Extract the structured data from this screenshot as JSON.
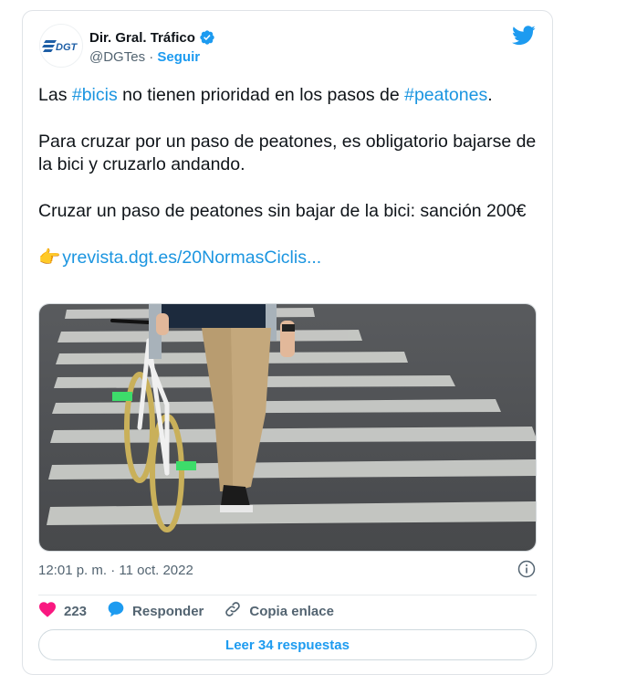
{
  "account": {
    "display_name": "Dir. Gral. Tráfico",
    "handle": "@DGTes",
    "separator": "·",
    "follow_label": "Seguir",
    "logo_text": "DGT"
  },
  "tweet": {
    "para1": {
      "t1": "Las ",
      "h1": "#bicis",
      "t2": " no tienen prioridad en los pasos de ",
      "h2": "#peatones",
      "t3": "."
    },
    "para2": "Para cruzar por un paso de peatones, es obligatorio bajarse de la bici y cruzarlo andando.",
    "para3": "Cruzar un paso de peatones sin bajar de la bici: sanción 200€",
    "link_emoji": "👉",
    "link_text": "yrevista.dgt.es/20NormasCiclis..."
  },
  "timestamp": "12:01 p. m. · 11 oct. 2022",
  "actions": {
    "like_count": "223",
    "reply_label": "Responder",
    "copy_link_label": "Copia enlace"
  },
  "read_replies_label": "Leer 34 respuestas",
  "icons": {
    "verified": "verified-badge-icon",
    "bird": "twitter-bird-icon",
    "info": "info-icon",
    "heart": "heart-icon",
    "reply": "speech-bubble-icon",
    "link": "link-icon"
  },
  "colors": {
    "accent": "#1d9bf0",
    "like": "#f91880",
    "text": "#0f1419",
    "muted": "#536471"
  }
}
